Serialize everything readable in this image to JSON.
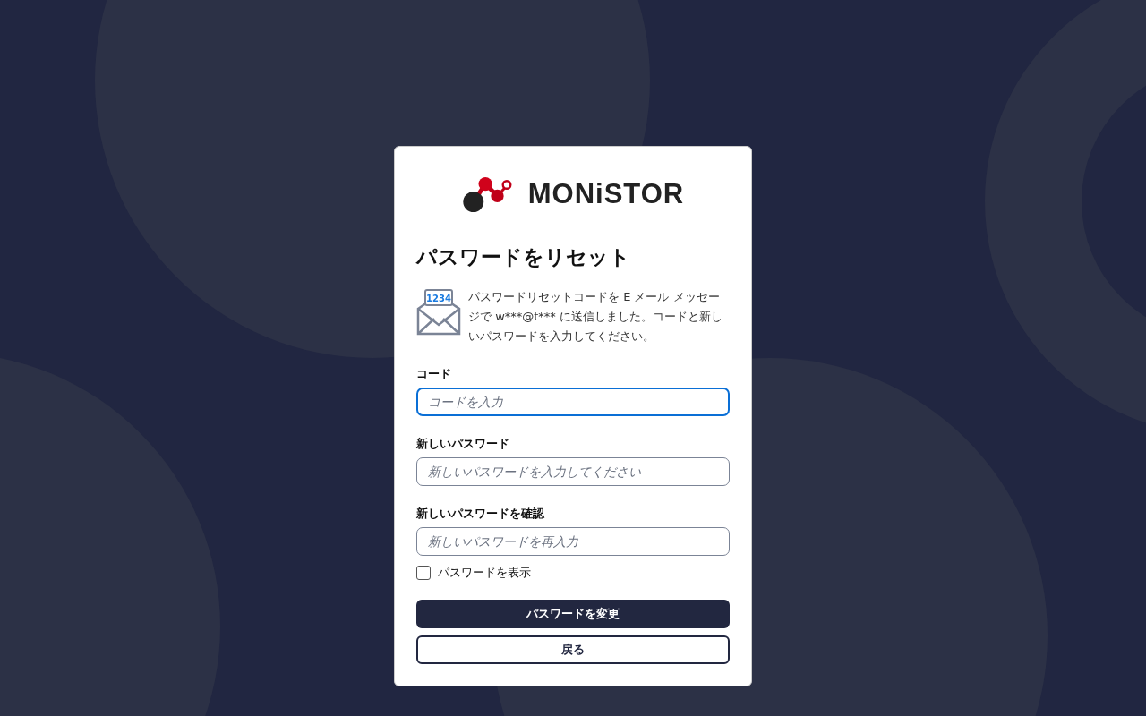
{
  "logo": {
    "text": "MONiSTOR"
  },
  "title": "パスワードをリセット",
  "notice": {
    "badge": "1234",
    "text": "パスワードリセットコードを E メール メッセージで w***@t*** に送信しました。コードと新しいパスワードを入力してください。"
  },
  "fields": [
    {
      "label": "コード",
      "placeholder": "コードを入力",
      "focused": true
    },
    {
      "label": "新しいパスワード",
      "placeholder": "新しいパスワードを入力してください",
      "focused": false
    },
    {
      "label": "新しいパスワードを確認",
      "placeholder": "新しいパスワードを再入力",
      "focused": false
    }
  ],
  "show_password": {
    "label": "パスワードを表示",
    "checked": false
  },
  "buttons": [
    {
      "label": "パスワードを変更",
      "kind": "primary"
    },
    {
      "label": "戻る",
      "kind": "secondary"
    }
  ]
}
